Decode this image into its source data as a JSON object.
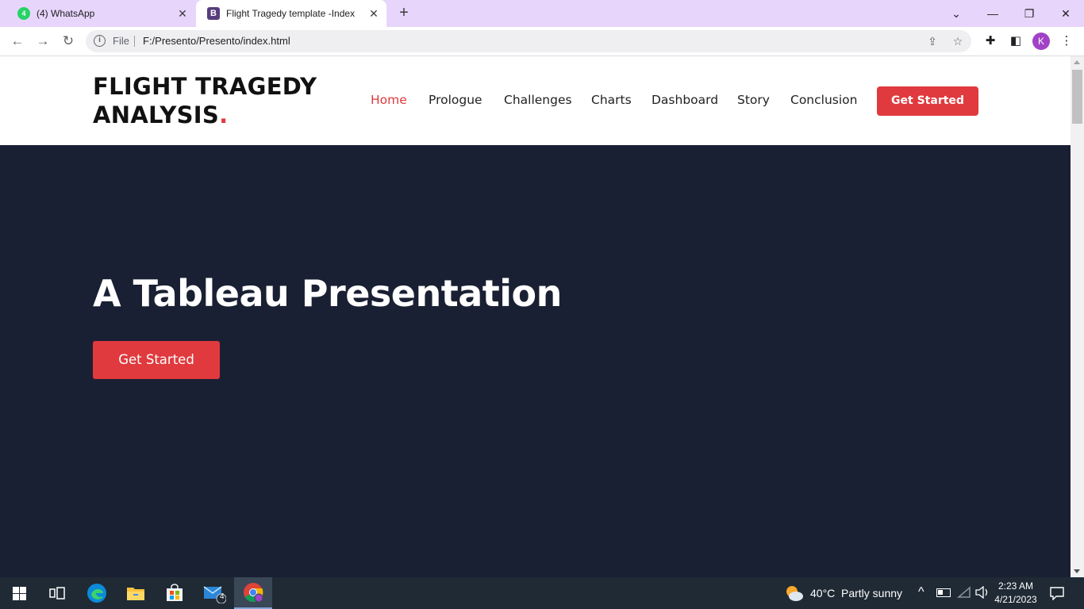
{
  "browser": {
    "tabs": [
      {
        "title": "(4) WhatsApp",
        "favicon": "whatsapp-icon",
        "favicon_text": "4",
        "active": false
      },
      {
        "title": "Flight Tragedy template -Index",
        "favicon": "bootstrap-icon",
        "favicon_text": "B",
        "active": true
      }
    ],
    "address": {
      "scheme_label": "File",
      "url": "F:/Presento/Presento/index.html"
    },
    "profile_initial": "K"
  },
  "site": {
    "logo": {
      "line1": "FLIGHT TRAGEDY",
      "line2": "ANALYSIS",
      "dot": "."
    },
    "nav": [
      "Home",
      "Prologue",
      "Challenges",
      "Charts",
      "Dashboard",
      "Story",
      "Conclusion"
    ],
    "active_nav": "Home",
    "header_cta": "Get Started",
    "hero": {
      "title": "A Tableau Presentation",
      "cta": "Get Started"
    },
    "colors": {
      "accent": "#e03a3e",
      "hero_bg": "#1a2033"
    }
  },
  "taskbar": {
    "mail_badge": "4",
    "weather": {
      "temp": "40°C",
      "condition": "Partly sunny"
    },
    "time": "2:23 AM",
    "date": "4/21/2023"
  }
}
